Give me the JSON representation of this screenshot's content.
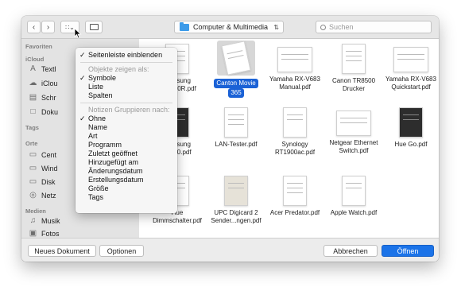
{
  "toolbar": {
    "back_icon": "chevron-left-icon",
    "forward_icon": "chevron-right-icon",
    "view_icon": "icon-grid-icon",
    "new_folder_icon": "new-folder-icon",
    "location": "Computer & Multimedia",
    "search_placeholder": "Suchen"
  },
  "sidebar": {
    "favorites_header": "Favoriten",
    "icloud_header": "iCloud",
    "icloud_items": [
      {
        "label": "Textl",
        "icon": "textedit-icon"
      },
      {
        "label": "iClou",
        "icon": "cloud-icon"
      },
      {
        "label": "Schr",
        "icon": "desktop-icon"
      },
      {
        "label": "Doku",
        "icon": "document-icon"
      }
    ],
    "tags_header": "Tags",
    "places_header": "Orte",
    "places_items": [
      {
        "label": "Cent",
        "icon": "disk-icon"
      },
      {
        "label": "Wind",
        "icon": "disk-icon"
      },
      {
        "label": "Disk",
        "icon": "disk-icon"
      },
      {
        "label": "Netz",
        "icon": "globe-icon"
      }
    ],
    "media_header": "Medien",
    "media_items": [
      {
        "label": "Musik",
        "icon": "music-icon"
      },
      {
        "label": "Fotos",
        "icon": "camera-icon"
      }
    ]
  },
  "files": [
    {
      "line1": "Samsung",
      "line2": "75Q900R.pdf"
    },
    {
      "line1": "Canton Movie",
      "line2": "365"
    },
    {
      "line1": "Yamaha RX-V683",
      "line2": "Manual.pdf"
    },
    {
      "line1": "Canon TR8500",
      "line2": "Drucker"
    },
    {
      "line1": "Yamaha RX-V683",
      "line2": "Quickstart.pdf"
    },
    {
      "line1": "Samsung",
      "line2": "J7000.pdf"
    },
    {
      "line1": "LAN-Tester.pdf",
      "line2": ""
    },
    {
      "line1": "Synology",
      "line2": "RT1900ac.pdf"
    },
    {
      "line1": "Netgear Ethernet",
      "line2": "Switch.pdf"
    },
    {
      "line1": "Hue Go.pdf",
      "line2": ""
    },
    {
      "line1": "Hue",
      "line2": "Dimmschalter.pdf"
    },
    {
      "line1": "UPC Digicard 2",
      "line2": "Sender...ngen.pdf"
    },
    {
      "line1": "Acer Predator.pdf",
      "line2": ""
    },
    {
      "line1": "Apple Watch.pdf",
      "line2": ""
    }
  ],
  "menu": {
    "show_sidebar": "Seitenleiste einblenden",
    "view_header": "Objekte zeigen als:",
    "view_options": [
      "Symbole",
      "Liste",
      "Spalten"
    ],
    "group_header": "Notizen Gruppieren nach:",
    "group_options": [
      "Ohne",
      "Name",
      "Art",
      "Programm",
      "Zuletzt geöffnet",
      "Hinzugefügt am",
      "Änderungsdatum",
      "Erstellungsdatum",
      "Größe",
      "Tags"
    ],
    "check_mark": "✓"
  },
  "bottom": {
    "new_document": "Neues Dokument",
    "options": "Optionen",
    "cancel": "Abbrechen",
    "open": "Öffnen"
  },
  "colors": {
    "accent": "#1b73e8",
    "selection": "#1b62d6",
    "folder": "#3d9be9"
  }
}
